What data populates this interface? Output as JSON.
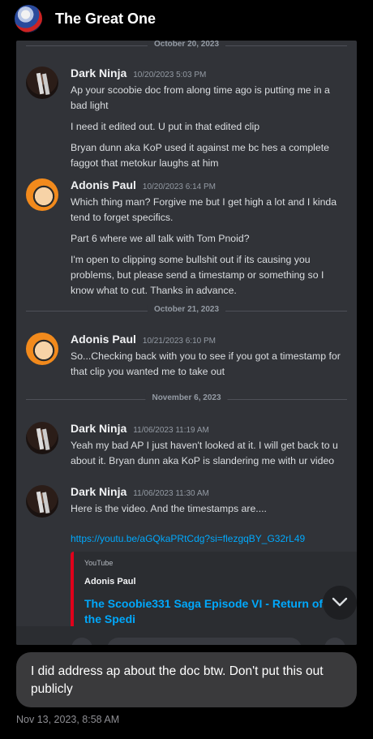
{
  "header": {
    "title": "The Great One"
  },
  "chat": {
    "dividers": [
      "October 20, 2023",
      "October 21, 2023",
      "November 6, 2023"
    ],
    "messages": [
      {
        "author": "Dark Ninja",
        "time": "10/20/2023 5:03 PM",
        "lines": [
          "Ap your scoobie doc from along time ago is putting me in a bad light",
          "I need it edited out. U put in that edited clip",
          "Bryan dunn aka KoP used it against me bc hes a complete faggot that metokur laughs at him"
        ]
      },
      {
        "author": "Adonis Paul",
        "time": "10/20/2023 6:14 PM",
        "lines": [
          "Which thing man? Forgive me but I get high a lot and I kinda tend to forget specifics.",
          "Part 6 where we all talk with Tom Pnoid?",
          "I'm open to clipping some bullshit out if its causing you problems, but please send a timestamp or something so I know what to cut. Thanks in advance."
        ]
      },
      {
        "author": "Adonis Paul",
        "time": "10/21/2023 6:10 PM",
        "lines": [
          "So...Checking back with you to see if you got a timestamp for that clip you wanted me to take out"
        ]
      },
      {
        "author": "Dark Ninja",
        "time": "11/06/2023 11:19 AM",
        "lines": [
          "Yeah my bad AP I just haven't looked at it. I will get back to u about it. Bryan dunn aka KoP is slandering me with ur video"
        ]
      },
      {
        "author": "Dark Ninja",
        "time": "11/06/2023 11:30 AM",
        "lines": [
          "Here is the video. And the timestamps are...."
        ],
        "link": "https://youtu.be/aGQkaPRtCdg?si=flezgqBY_G32rL49"
      }
    ],
    "embed": {
      "provider": "YouTube",
      "author": "Adonis Paul",
      "title": "The Scoobie331 Saga Episode VI - Return of the Spedi"
    }
  },
  "bubble": {
    "text": "I did address ap about the doc btw. Don't put this out publicly"
  },
  "timestamp": "Nov 13, 2023, 8:58 AM",
  "colors": {
    "accent_link": "#00a8fc",
    "embed_bar": "#e0001b",
    "discord_bg": "#313338"
  }
}
